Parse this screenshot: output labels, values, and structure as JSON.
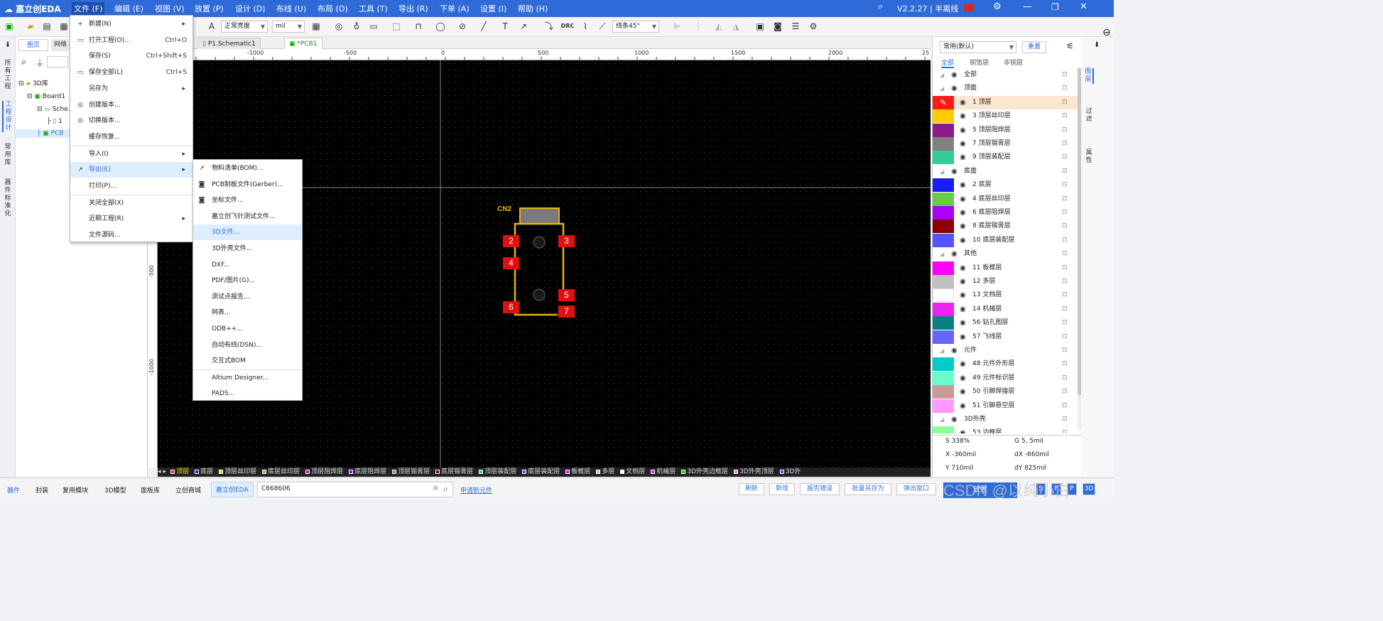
{
  "titlebar": {
    "logo": "嘉立创EDA",
    "menus": [
      "文件 (F)",
      "编辑 (E)",
      "视图 (V)",
      "放置 (P)",
      "设计 (D)",
      "布线 (U)",
      "布局 (O)",
      "工具 (T)",
      "导出 (R)",
      "下单 (A)",
      "设置 (I)",
      "帮助 (H)"
    ],
    "version": "V2.2.27 | 半离线"
  },
  "toolbar": {
    "brightness": "正常亮度",
    "unit": "mil",
    "line_angle": "线条45°",
    "drc": "DRC"
  },
  "left_strip": {
    "tabs": [
      "所有工程",
      "工程设计",
      "常用库",
      "器件标准化"
    ]
  },
  "left_panel": {
    "tabs": [
      "图页",
      "网络"
    ],
    "tree": [
      "3D库",
      "Board1",
      "Sche...",
      "1",
      "PCB"
    ]
  },
  "doc_tabs": [
    "P1.Schematic1",
    "*PCB1"
  ],
  "ruler": {
    "h_labels": [
      "-1000",
      "-500",
      "0",
      "500",
      "1000",
      "1500",
      "2000",
      "25"
    ],
    "v_labels": [
      "-500",
      "-1000"
    ]
  },
  "pcb": {
    "designator": "CN2",
    "pads": [
      "2",
      "3",
      "4",
      "5",
      "6",
      "7"
    ]
  },
  "layer_bar": [
    {
      "name": "顶层",
      "color": "#ff2020"
    },
    {
      "name": "底层",
      "color": "#2020ff"
    },
    {
      "name": "顶层丝印层",
      "color": "#ffcc00"
    },
    {
      "name": "底层丝印层",
      "color": "#66cc44"
    },
    {
      "name": "顶层阻焊层",
      "color": "#aa22aa"
    },
    {
      "name": "底层阻焊层",
      "color": "#aa00ff"
    },
    {
      "name": "顶层锡膏层",
      "color": "#888888"
    },
    {
      "name": "底层锡膏层",
      "color": "#880000"
    },
    {
      "name": "顶层装配层",
      "color": "#33cc99"
    },
    {
      "name": "底层装配层",
      "color": "#5555ff"
    },
    {
      "name": "板框层",
      "color": "#ff00ff"
    },
    {
      "name": "多层",
      "color": "#c0c0c0"
    },
    {
      "name": "文档层",
      "color": "#ffffff"
    },
    {
      "name": "机械层",
      "color": "#ee22ee"
    },
    {
      "name": "3D外壳边框层",
      "color": "#22cc22"
    },
    {
      "name": "3D外壳顶层",
      "color": "#dd88dd"
    },
    {
      "name": "3D外",
      "color": "#3355ff"
    }
  ],
  "right_panel": {
    "preset": "常用(默认)",
    "reset": "重置",
    "tabs": [
      "全部",
      "铜箔层",
      "非铜层"
    ],
    "layers": [
      {
        "name": "全部",
        "color": "",
        "group": true
      },
      {
        "name": "顶面",
        "color": "",
        "group": true
      },
      {
        "name": "1 顶层",
        "color": "#ff1a1a",
        "active": true
      },
      {
        "name": "3 顶层丝印层",
        "color": "#ffcc00"
      },
      {
        "name": "5 顶层阻焊层",
        "color": "#8b1a8b"
      },
      {
        "name": "7 顶层锡膏层",
        "color": "#808080"
      },
      {
        "name": "9 顶层装配层",
        "color": "#33cc99"
      },
      {
        "name": "底面",
        "color": "",
        "group": true
      },
      {
        "name": "2 底层",
        "color": "#1a1aff"
      },
      {
        "name": "4 底层丝印层",
        "color": "#66cc44"
      },
      {
        "name": "6 底层阻焊层",
        "color": "#aa00ff"
      },
      {
        "name": "8 底层锡膏层",
        "color": "#8b0000"
      },
      {
        "name": "10 底层装配层",
        "color": "#5555ff"
      },
      {
        "name": "其他",
        "color": "",
        "group": true
      },
      {
        "name": "11 板框层",
        "color": "#ff00ff"
      },
      {
        "name": "12 多层",
        "color": "#c0c0c0"
      },
      {
        "name": "13 文档层",
        "color": "#ffffff"
      },
      {
        "name": "14 机械层",
        "color": "#ee22ee"
      },
      {
        "name": "56 钻孔图层",
        "color": "#0a8080"
      },
      {
        "name": "57 飞线层",
        "color": "#6666ff"
      },
      {
        "name": "元件",
        "color": "",
        "group": true
      },
      {
        "name": "48 元件外形层",
        "color": "#00cccc"
      },
      {
        "name": "49 元件标识层",
        "color": "#66ffcc"
      },
      {
        "name": "50 引脚焊接层",
        "color": "#cc9999"
      },
      {
        "name": "51 引脚悬空层",
        "color": "#ff99ff"
      },
      {
        "name": "3D外壳",
        "color": "",
        "group": true
      },
      {
        "name": "53 边框层",
        "color": "#88ff99"
      }
    ],
    "side_tabs": [
      "图层",
      "过滤",
      "属性"
    ]
  },
  "coords": {
    "s": "S   338%",
    "g": "G   5, 5mil",
    "x": "X   -360mil",
    "dx": "dX   -660mil",
    "y": "Y   710mil",
    "dy": "dY   825mil"
  },
  "statusbar": {
    "tabs": [
      "器件",
      "封装",
      "复用模块",
      "3D模型",
      "面板库",
      "立创商城",
      "嘉立创EDA"
    ],
    "search_value": "C668606",
    "apply_link": "申请新元件",
    "buttons": [
      "刷新",
      "新增",
      "报告错误",
      "批量另存为",
      "弹出窗口"
    ],
    "place_button": "放置",
    "mini_buttons": [
      "S",
      "F",
      "P",
      "3D"
    ]
  },
  "file_menu": {
    "items": [
      {
        "label": "新建(N)",
        "key": "",
        "arrow": true,
        "icon": "+"
      },
      {
        "label": "打开工程(O)...",
        "key": "Ctrl+O",
        "icon": "▭"
      },
      {
        "label": "保存(S)",
        "key": "Ctrl+Shift+S"
      },
      {
        "label": "保存全部(L)",
        "key": "Ctrl+S",
        "icon": "▭"
      },
      {
        "label": "另存为",
        "key": "",
        "arrow": true
      },
      {
        "label": "创建版本...",
        "key": "",
        "icon": "◎"
      },
      {
        "label": "切换版本...",
        "key": "",
        "icon": "◎"
      },
      {
        "label": "缓存恢复...",
        "key": ""
      },
      {
        "label": "导入(I)",
        "key": "",
        "arrow": true
      },
      {
        "label": "导出(E)",
        "key": "",
        "arrow": true,
        "icon": "↗",
        "highlight": true
      },
      {
        "label": "打印(P)...",
        "key": ""
      },
      {
        "label": "关闭全部(X)",
        "key": ""
      },
      {
        "label": "近期工程(R)",
        "key": "",
        "arrow": true
      },
      {
        "label": "文件源码...",
        "key": ""
      }
    ]
  },
  "export_menu": {
    "items": [
      {
        "label": "物料清单(BOM)...",
        "icon": "↗"
      },
      {
        "label": "PCB制板文件(Gerber)...",
        "icon": "◙"
      },
      {
        "label": "坐标文件...",
        "icon": "◙"
      },
      {
        "label": "嘉立创飞针测试文件..."
      },
      {
        "label": "3D文件...",
        "highlight": true
      },
      {
        "label": "3D外壳文件..."
      },
      {
        "label": "DXF..."
      },
      {
        "label": "PDF/图片(G)..."
      },
      {
        "label": "测试点报告..."
      },
      {
        "label": "网表..."
      },
      {
        "label": "ODB++..."
      },
      {
        "label": "自动布线(DSN)..."
      },
      {
        "label": "交互式BOM"
      },
      {
        "label": "Altium Designer..."
      },
      {
        "label": "PADS..."
      }
    ]
  },
  "watermark": "CSDN @以纯小白"
}
